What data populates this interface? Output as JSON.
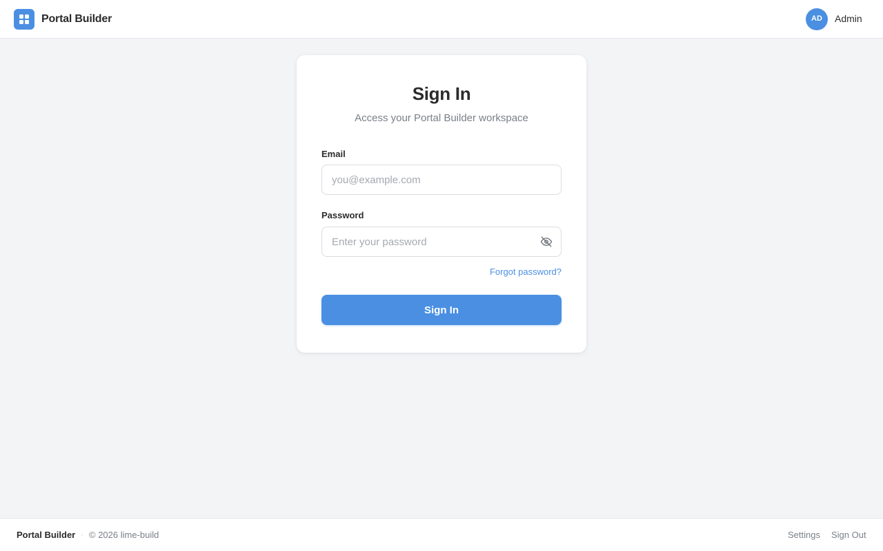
{
  "header": {
    "app_title": "Portal Builder",
    "logo_icon": "grid-icon",
    "user": {
      "initials": "AD",
      "name": "Admin"
    }
  },
  "login": {
    "title": "Sign In",
    "subtitle": "Access your Portal Builder workspace",
    "email": {
      "label": "Email",
      "placeholder": "you@example.com",
      "value": ""
    },
    "password": {
      "label": "Password",
      "placeholder": "Enter your password",
      "value": "",
      "toggle_icon": "eye-off-icon"
    },
    "forgot_label": "Forgot password?",
    "submit_label": "Sign In"
  },
  "footer": {
    "brand": "Portal Builder",
    "separator": "·",
    "copyright": "© 2026 lime-build",
    "links": [
      {
        "label": "Settings"
      },
      {
        "label": "Sign Out"
      }
    ]
  },
  "colors": {
    "accent": "#4a8fe2",
    "background": "#f3f4f6",
    "text": "#2b2b2b",
    "muted": "#7a7f87"
  }
}
